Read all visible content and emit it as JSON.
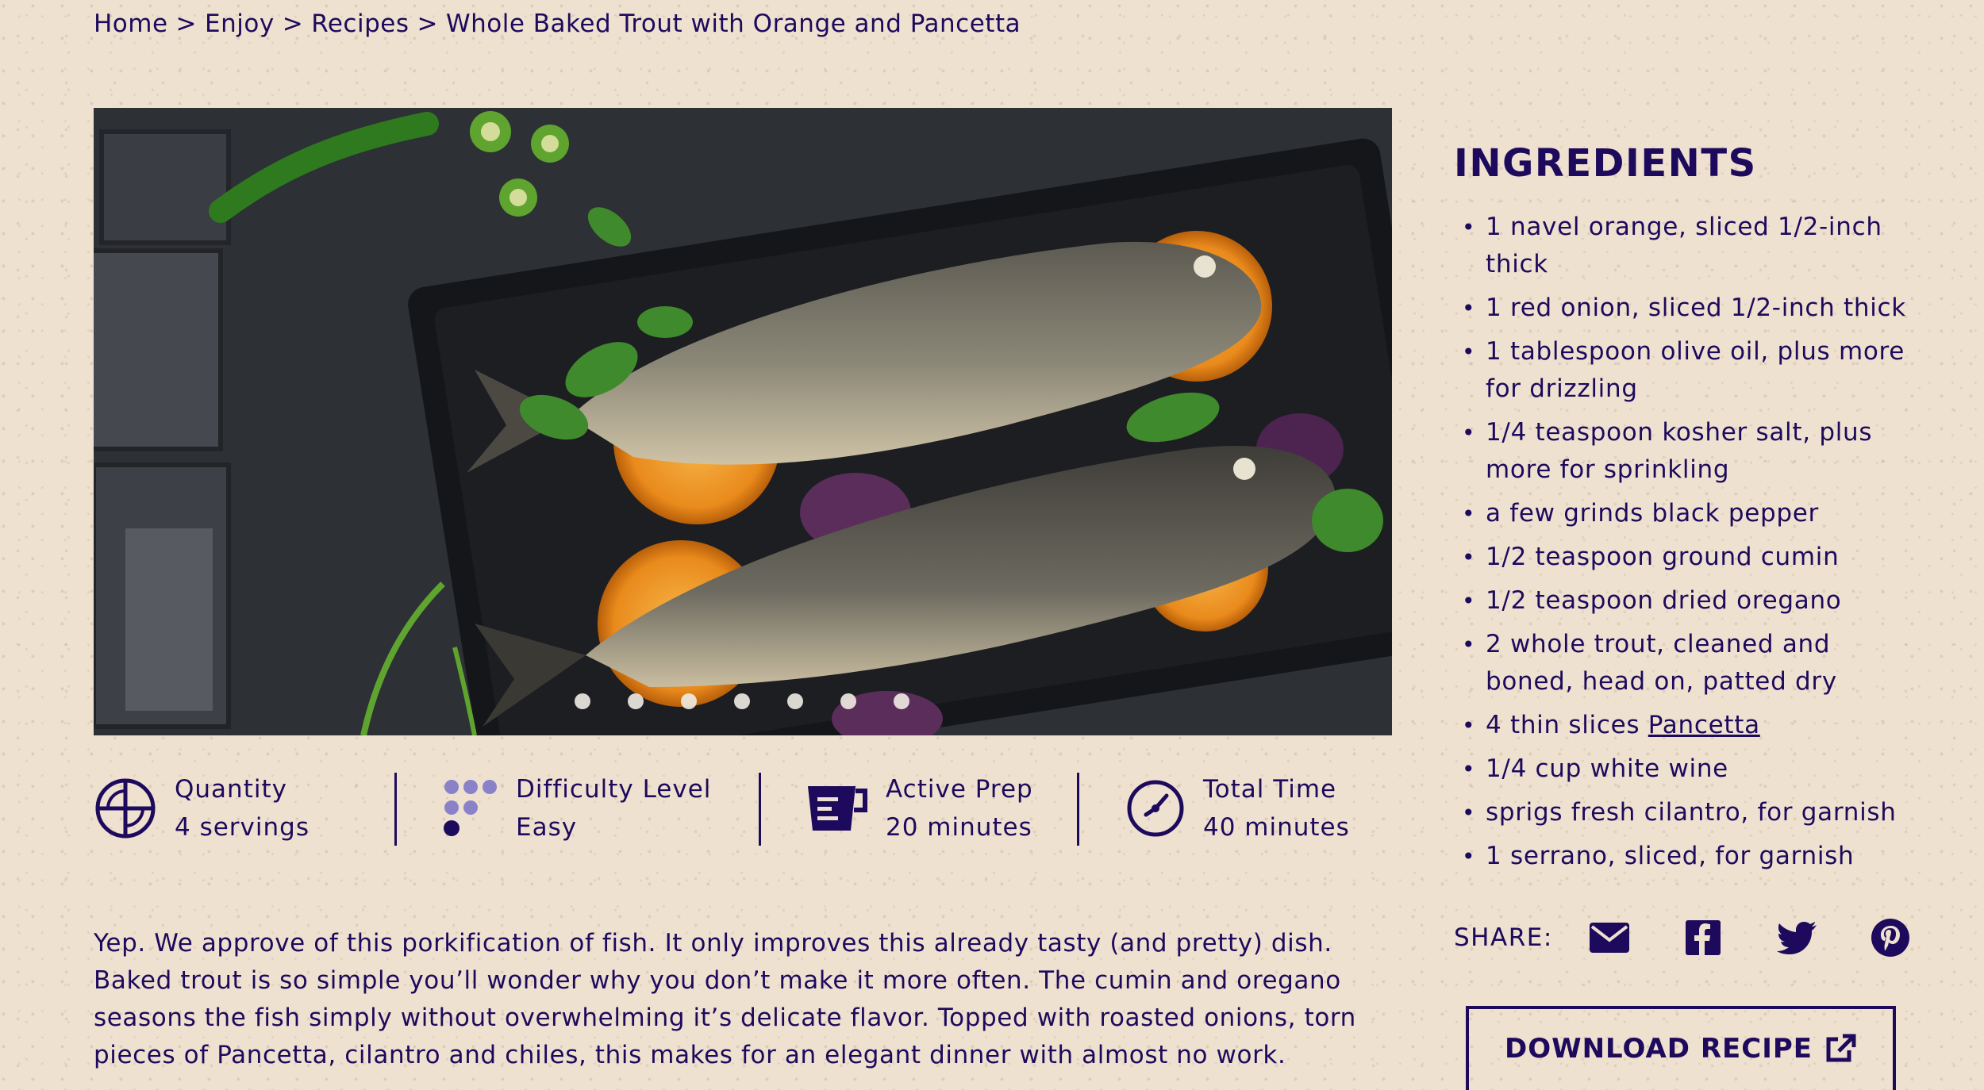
{
  "breadcrumb": {
    "items": [
      "Home",
      "Enjoy",
      "Recipes",
      "Whole Baked Trout with Orange and Pancetta"
    ],
    "separator": ">"
  },
  "hero": {
    "slide_count": 7,
    "active_slide": 1
  },
  "stats": {
    "quantity": {
      "label": "Quantity",
      "value": "4 servings",
      "icon": "servings-icon"
    },
    "difficulty": {
      "label": "Difficulty Level",
      "value": "Easy",
      "icon": "difficulty-dots-icon"
    },
    "prep": {
      "label": "Active Prep",
      "value": "20 minutes",
      "icon": "measuring-cup-icon"
    },
    "total": {
      "label": "Total Time",
      "value": "40 minutes",
      "icon": "clock-icon"
    }
  },
  "description": "Yep. We approve of this porkification of fish. It only improves this already tasty (and pretty) dish. Baked trout is so simple you’ll wonder why you don’t make it more often. The cumin and oregano seasons the fish simply without overwhelming it’s delicate flavor. Topped with roasted onions, torn pieces of Pancetta, cilantro and chiles, this makes for an elegant dinner with almost no work.",
  "ingredients": {
    "title": "INGREDIENTS",
    "items": [
      "1 navel orange, sliced 1/2-inch thick",
      "1 red onion, sliced 1/2-inch thick",
      "1 tablespoon olive oil, plus more for drizzling",
      "1/4 teaspoon kosher salt, plus more for sprinkling",
      "a few grinds black pepper",
      "1/2 teaspoon ground cumin",
      "1/2 teaspoon dried oregano",
      "2 whole trout, cleaned and boned, head on, patted dry"
    ],
    "pancetta_prefix": "4 thin slices ",
    "pancetta_link": "Pancetta",
    "items_after": [
      "1/4 cup white wine",
      "sprigs fresh cilantro, for garnish",
      "1 serrano, sliced, for garnish"
    ]
  },
  "share": {
    "label": "SHARE:",
    "icons": [
      "email-icon",
      "facebook-icon",
      "twitter-icon",
      "pinterest-icon"
    ]
  },
  "download": {
    "label": "DOWNLOAD RECIPE",
    "icon": "external-link-icon"
  },
  "colors": {
    "text": "#1d0a5c",
    "background": "#efe1d0",
    "accent_light": "#8a82c9"
  }
}
